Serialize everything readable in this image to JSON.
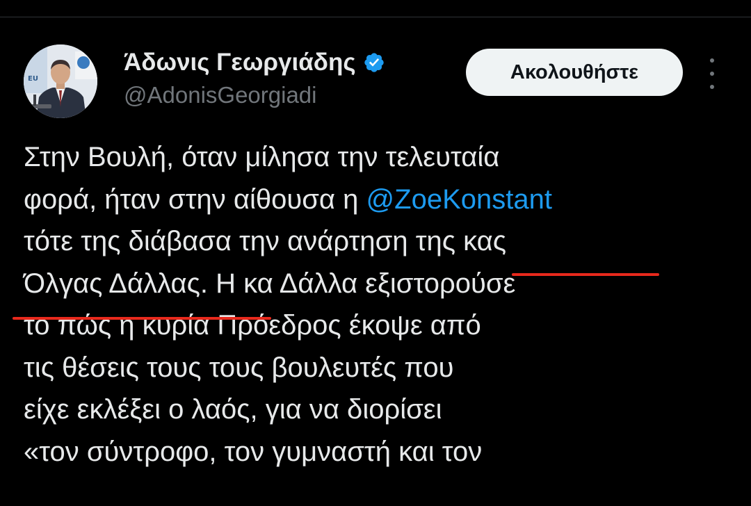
{
  "tweet": {
    "author": {
      "display_name": "Άδωνις Γεωργιάδης",
      "handle": "@AdonisGeorgiadi",
      "verified_icon": "verified-badge-icon",
      "avatar": "profile-photo"
    },
    "follow_label": "Ακολουθήστε",
    "more_icon": "more-options-icon",
    "text_lines": {
      "l1": "Στην Βουλή, όταν μίλησα την τελευταία",
      "l2_prefix": "φορά, ήταν στην αίθουσα η ",
      "l2_mention": "@ZoeKonstant",
      "l3_prefix": "τότε της διάβασα την ανάρτηση ",
      "l3_highlight": "της κας",
      "l4_highlight": "Όλγας Δάλλας.",
      "l4_rest": " Η κα Δάλλα εξιστορούσε",
      "l5": "το πώς η κυρία Πρόεδρος έκοψε από",
      "l6": "τις θέσεις τους τους βουλευτές που",
      "l7": "είχε εκλέξει ο λαός, για να διορίσει",
      "l8": "«τον σύντροφο, τον γυμναστή και τον"
    }
  },
  "colors": {
    "background": "#000000",
    "text": "#e7e9ea",
    "muted": "#71767b",
    "link": "#1d9bf0",
    "verified": "#1d9bf0",
    "underline_annotation": "#e8291c",
    "follow_button_bg": "#eff3f4"
  }
}
